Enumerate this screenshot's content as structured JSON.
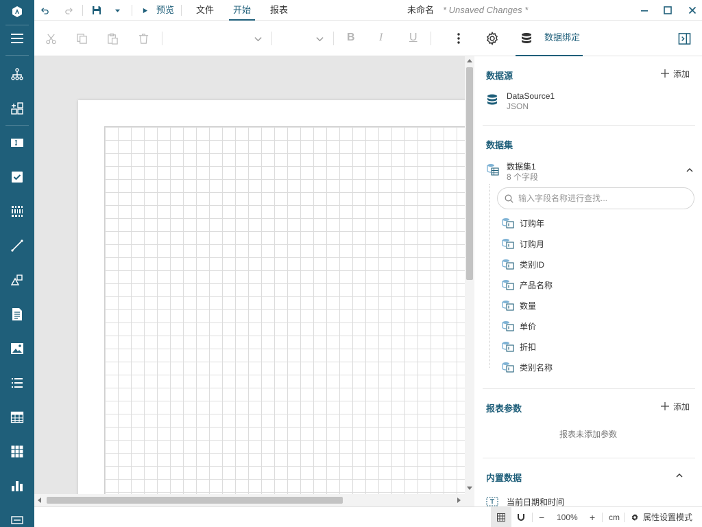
{
  "app": {
    "accent": "#1f5f7a"
  },
  "topbar": {
    "preview_label": "预览",
    "menus": [
      "文件",
      "开始",
      "报表"
    ],
    "active_menu": "开始",
    "doc_title": "未命名",
    "doc_status": "* Unsaved Changes *"
  },
  "toolbar": {
    "bold": "B",
    "italic": "I",
    "underline": "U",
    "panel_tab_label": "数据绑定"
  },
  "panel": {
    "datasource": {
      "title": "数据源",
      "add_label": "添加",
      "name": "DataSource1",
      "type": "JSON"
    },
    "dataset": {
      "title": "数据集",
      "name": "数据集1",
      "field_count": "8 个字段",
      "search_placeholder": "输入字段名称进行查找...",
      "fields": [
        "订购年",
        "订购月",
        "类别ID",
        "产品名称",
        "数量",
        "单价",
        "折扣",
        "类别名称"
      ]
    },
    "params": {
      "title": "报表参数",
      "add_label": "添加",
      "empty": "报表未添加参数"
    },
    "builtin": {
      "title": "内置数据",
      "first_item": "当前日期和时间"
    }
  },
  "status": {
    "zoom": "100%",
    "unit": "cm",
    "mode_label": "属性设置模式"
  }
}
